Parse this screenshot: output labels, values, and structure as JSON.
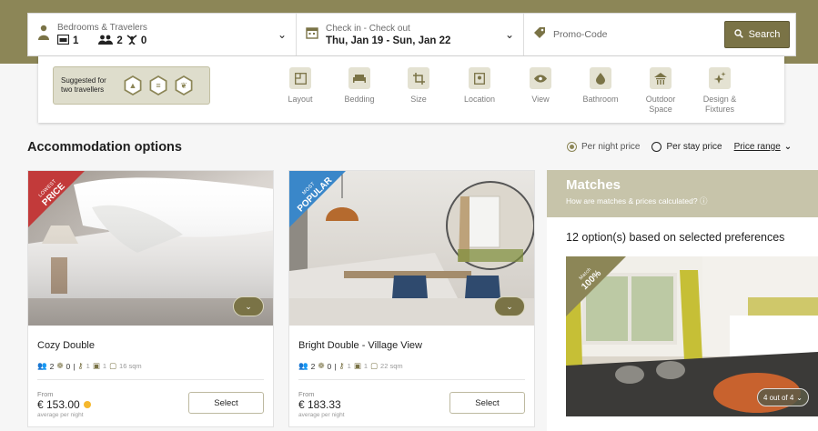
{
  "search": {
    "travelers_label": "Bedrooms & Travelers",
    "bedrooms": "1",
    "adults": "2",
    "children": "0",
    "dates_label": "Check in - Check out",
    "dates_value": "Thu, Jan 19 - Sun, Jan 22",
    "promo_placeholder": "Promo-Code",
    "search_label": "Search"
  },
  "preferences": {
    "suggested_line1": "Suggested for",
    "suggested_line2": "two travellers",
    "categories": [
      {
        "label": "Layout"
      },
      {
        "label": "Bedding"
      },
      {
        "label": "Size"
      },
      {
        "label": "Location"
      },
      {
        "label": "View"
      },
      {
        "label": "Bathroom"
      },
      {
        "label": "Outdoor Space"
      },
      {
        "label": "Design & Fixtures"
      }
    ]
  },
  "section": {
    "title": "Accommodation options",
    "per_night": "Per night price",
    "per_stay": "Per stay price",
    "price_range": "Price range"
  },
  "rooms": [
    {
      "ribbon_small": "LOWEST",
      "ribbon_big": "PRICE",
      "ribbon_color": "#c23a3a",
      "name": "Cozy Double",
      "adults": "2",
      "kids": "0",
      "keys": "1",
      "beds": "1",
      "size": "16 sqm",
      "from": "From",
      "price": "€ 153.00",
      "avg": "average per night",
      "select": "Select"
    },
    {
      "ribbon_small": "MOST",
      "ribbon_big": "POPULAR",
      "ribbon_color": "#3a87c9",
      "name": "Bright Double - Village View",
      "adults": "2",
      "kids": "0",
      "keys": "1",
      "beds": "1",
      "size": "22 sqm",
      "from": "From",
      "price": "€ 183.33",
      "avg": "average per night",
      "select": "Select"
    }
  ],
  "matches": {
    "title": "Matches",
    "subtitle": "How are matches & prices calculated?",
    "count_text": "12 option(s) based on selected preferences",
    "match_small": "Match",
    "match_pct": "100%",
    "pager": "4 out of 4"
  },
  "colors": {
    "brand": "#8c8657",
    "brand_dark": "#7a7346",
    "rating_dot": "#f5b82e"
  }
}
